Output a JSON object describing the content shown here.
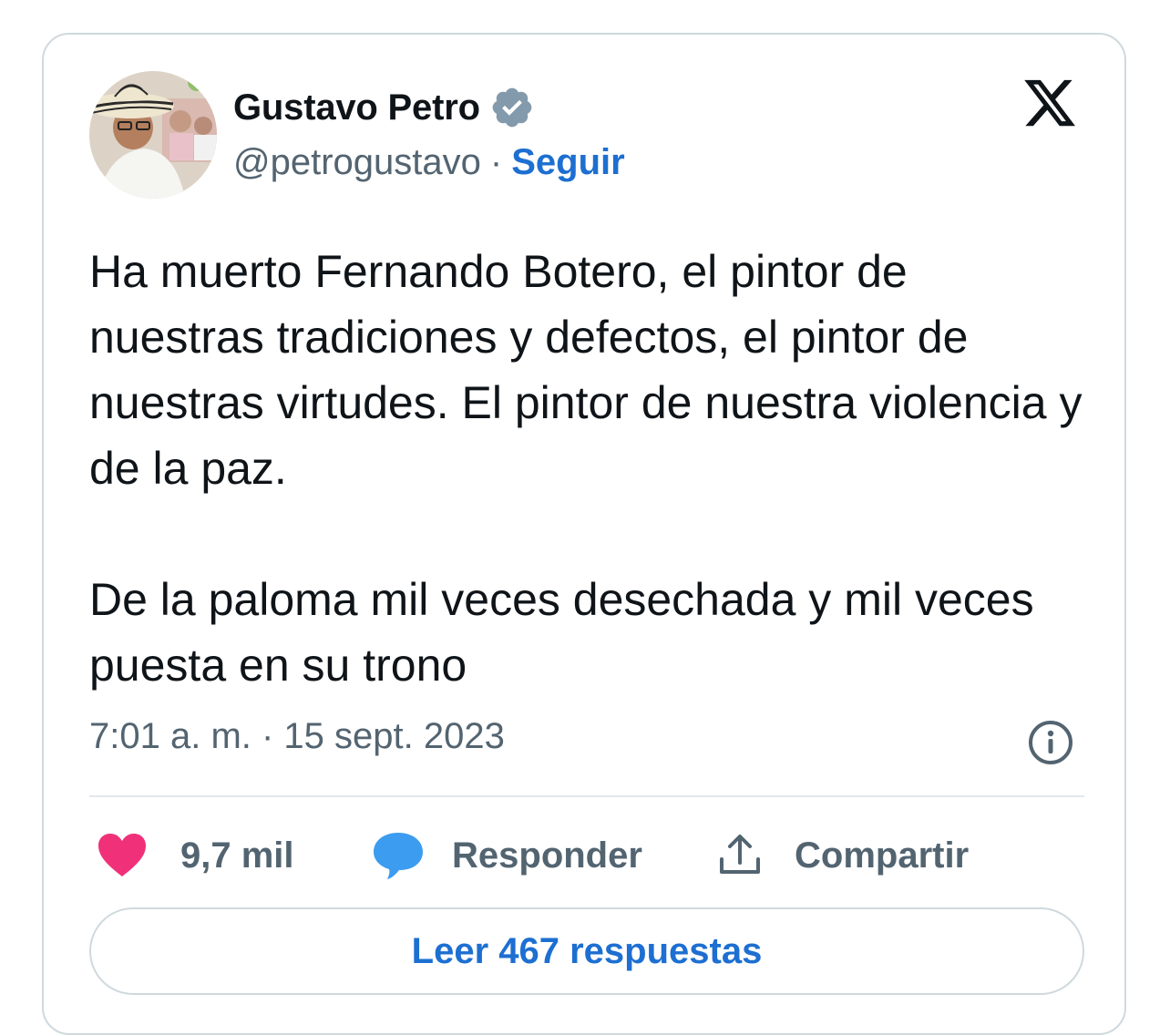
{
  "author": {
    "display_name": "Gustavo Petro",
    "handle": "@petrogustavo",
    "separator": "·",
    "follow_label": "Seguir",
    "verified_icon": "verified-badge-icon"
  },
  "tweet": {
    "paragraphs": [
      "Ha muerto Fernando Botero, el pintor de nuestras tradiciones y defectos, el pintor de nuestras virtudes. El pintor de nuestra violencia y de la paz.",
      "De la paloma mil veces desechada y mil veces puesta en su trono"
    ],
    "timestamp": "7:01 a. m. · 15 sept. 2023"
  },
  "actions": {
    "like_count": "9,7 mil",
    "reply_label": "Responder",
    "share_label": "Compartir"
  },
  "read_replies_label": "Leer 467 respuestas",
  "colors": {
    "link": "#1d6fd1",
    "heart": "#f0317a",
    "reply_bubble": "#3b9cf0",
    "secondary_text": "#536471",
    "verified": "#829aab"
  }
}
